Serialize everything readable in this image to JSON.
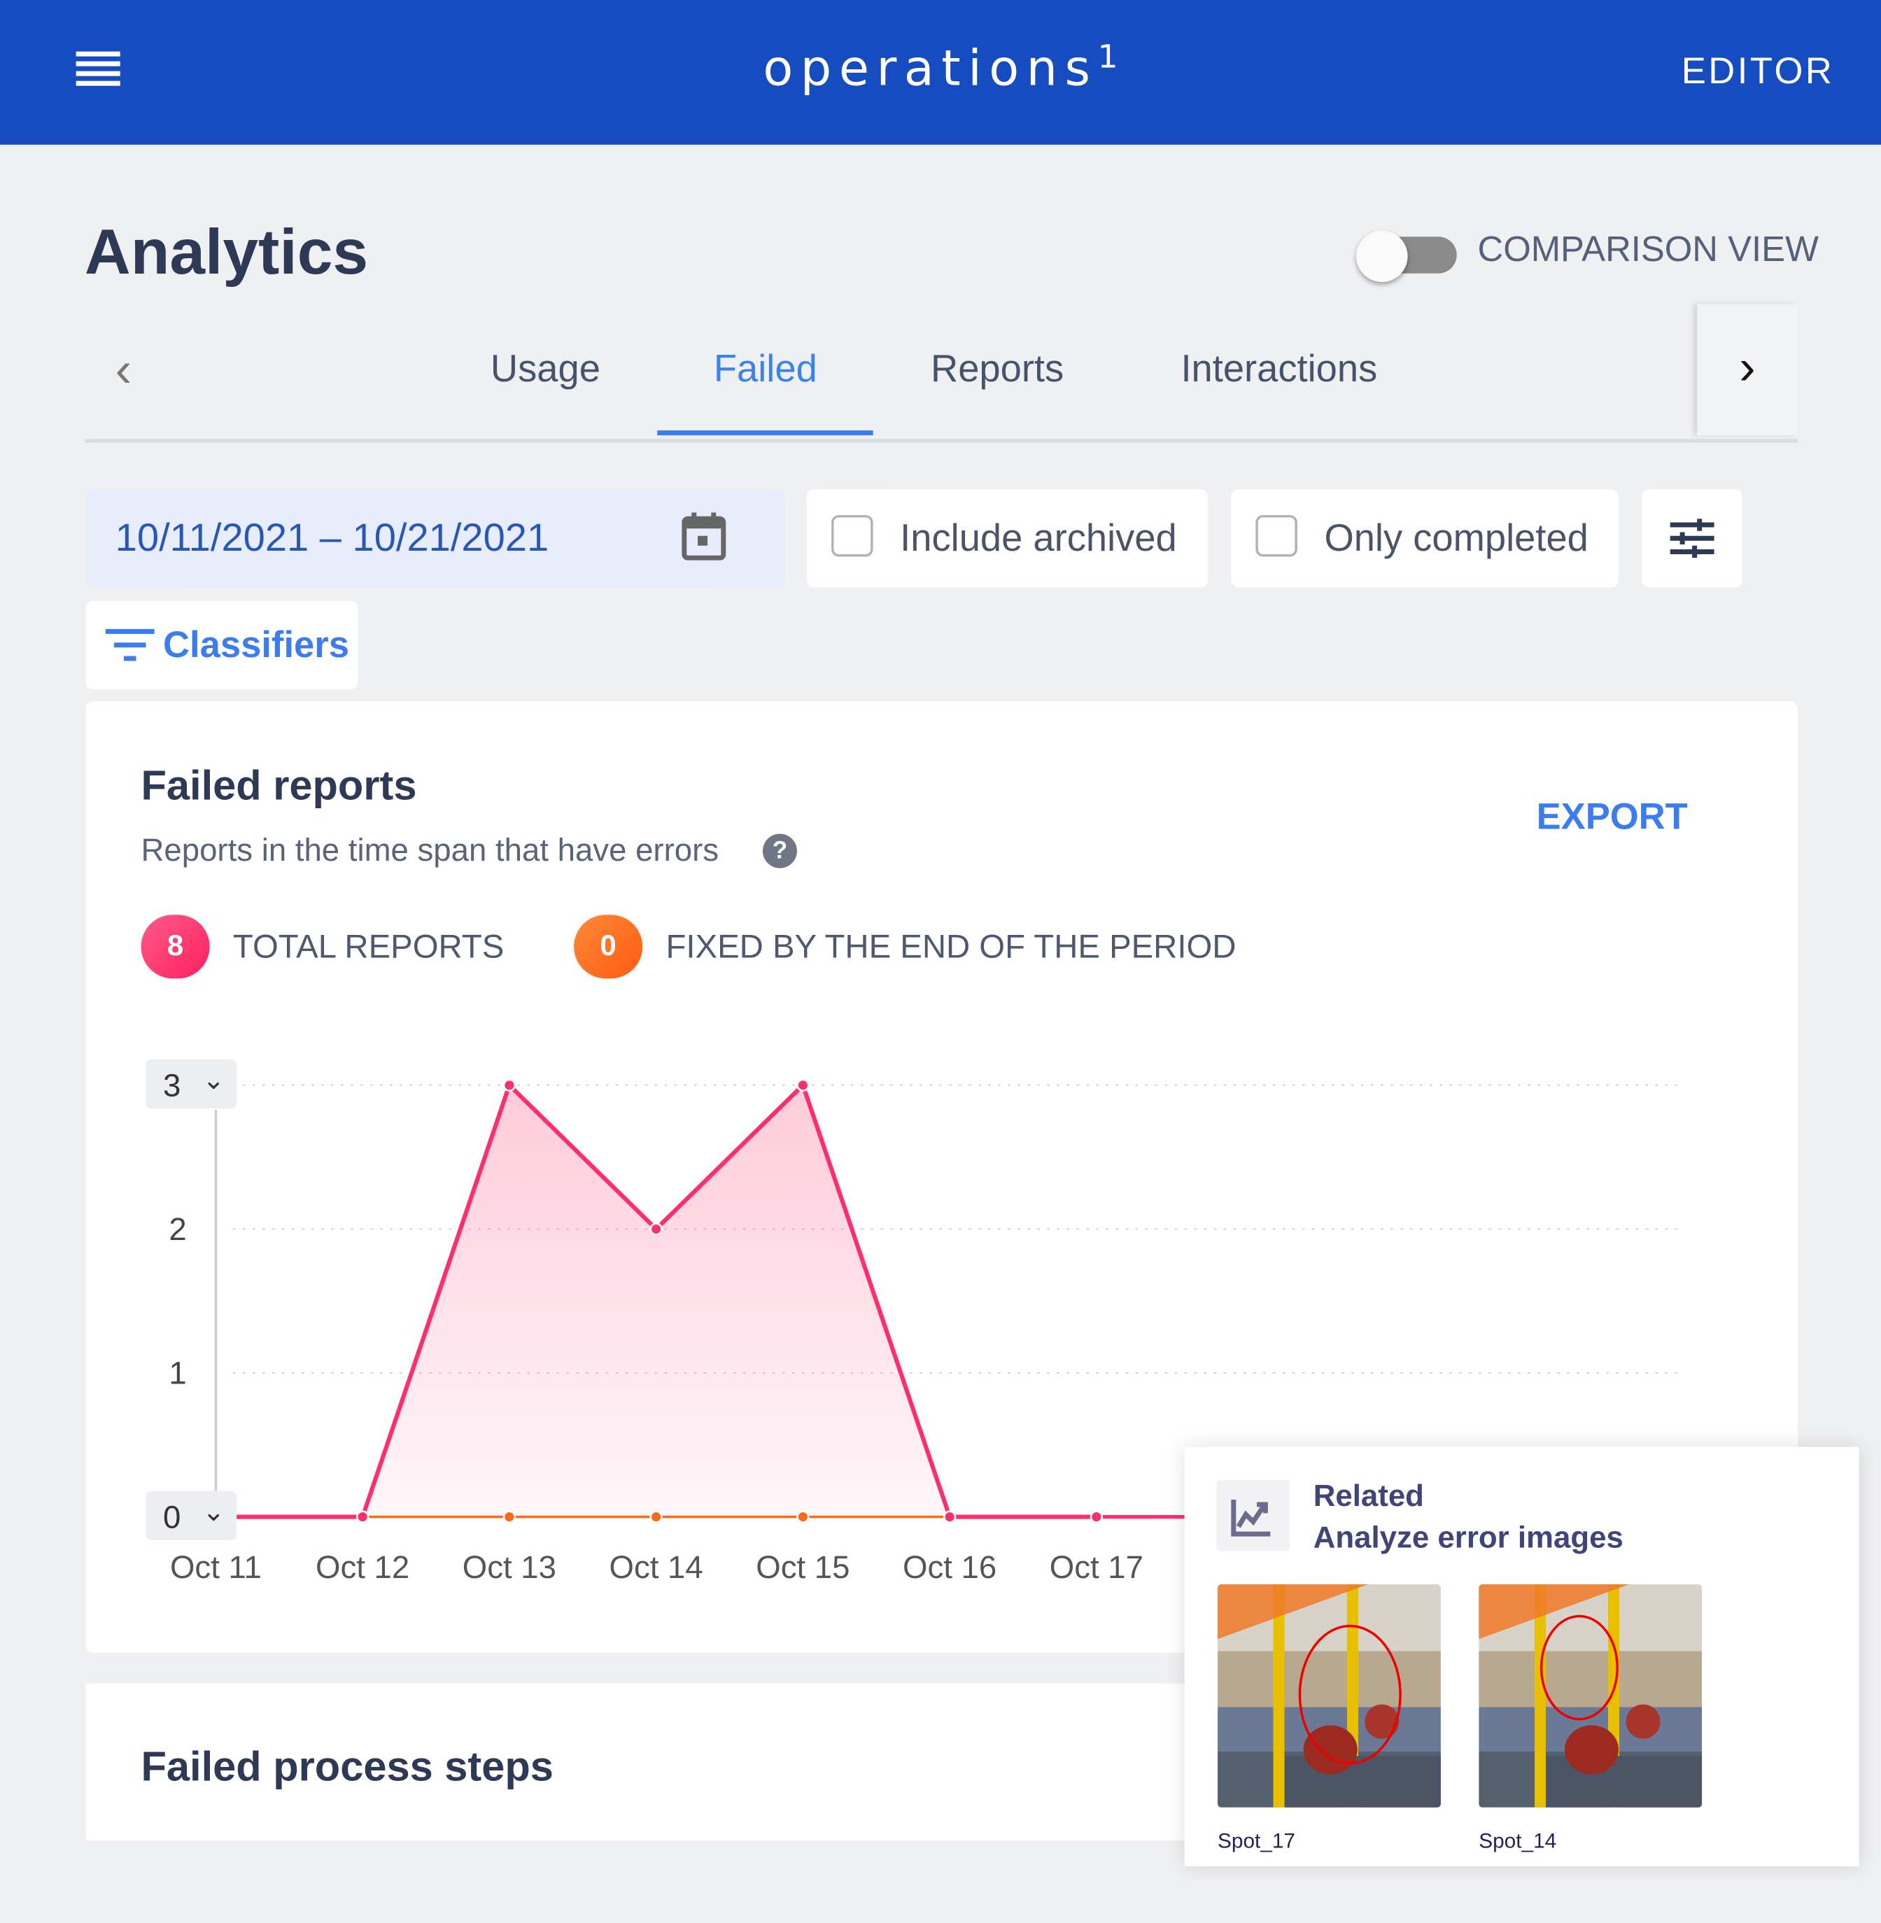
{
  "header": {
    "brand": "operations",
    "brand_sup": "1",
    "editor_label": "EDITOR",
    "menu_icon": "hamburger-menu-icon"
  },
  "page": {
    "title": "Analytics",
    "comparison_label": "COMPARISON VIEW",
    "comparison_on": false
  },
  "tabs": [
    {
      "label": "Usage",
      "active": false
    },
    {
      "label": "Failed",
      "active": true
    },
    {
      "label": "Reports",
      "active": false
    },
    {
      "label": "Interactions",
      "active": false
    }
  ],
  "filters": {
    "date_range": "10/11/2021 – 10/21/2021",
    "include_archived": "Include archived",
    "only_completed": "Only completed",
    "classifiers": "Classifiers"
  },
  "card": {
    "title": "Failed reports",
    "subtitle": "Reports in the time span that have errors",
    "export": "EXPORT",
    "total_count": "8",
    "total_label": "TOTAL REPORTS",
    "fixed_count": "0",
    "fixed_label": "FIXED BY THE END OF THE PERIOD",
    "ymax_select": "3",
    "ymin_select": "0"
  },
  "card2": {
    "title": "Failed process steps"
  },
  "popup": {
    "heading": "Related",
    "title": "Analyze error images",
    "images": [
      {
        "caption": "Spot_17"
      },
      {
        "caption": "Spot_14"
      }
    ]
  },
  "colors": {
    "brand": "#154dc0",
    "accent": "#3b7cf0",
    "total": "#ff2f6e",
    "fixed": "#ff6a1a"
  },
  "chart_data": {
    "type": "area",
    "categories": [
      "Oct 11",
      "Oct 12",
      "Oct 13",
      "Oct 14",
      "Oct 15",
      "Oct 16",
      "Oct 17"
    ],
    "series": [
      {
        "values": [
          0,
          0,
          3,
          2,
          3,
          0,
          0
        ],
        "color": "#ff2f6e"
      },
      {
        "values": [
          0,
          0,
          0,
          0,
          0,
          0,
          0
        ],
        "color": "#ff6a1a"
      }
    ],
    "yticks": [
      0,
      1,
      2,
      3
    ],
    "ylim": [
      0,
      3
    ],
    "grid": true
  }
}
